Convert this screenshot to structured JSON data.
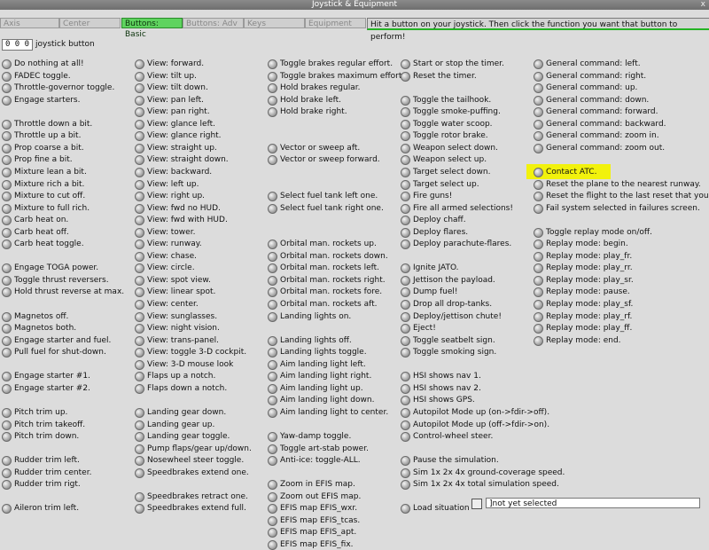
{
  "window": {
    "title": "Joystick & Equipment",
    "close_label": "x"
  },
  "tabs": [
    {
      "label": "Axis"
    },
    {
      "label": "Center"
    },
    {
      "label": "Buttons: Basic"
    },
    {
      "label": "Buttons: Adv"
    },
    {
      "label": "Keys"
    },
    {
      "label": "Equipment"
    }
  ],
  "hint": "Hit a button on your joystick. Then click the function you want that button to perform!",
  "joystick": {
    "value": "0 0 0",
    "label": "joystick button"
  },
  "highlight_color": "#f2f20c",
  "active_tab_color": "#5fd35f",
  "columns": [
    [
      "Do nothing at all!",
      "FADEC toggle.",
      "Throttle-governor toggle.",
      "Engage starters.",
      "",
      "Throttle down a bit.",
      "Throttle up a bit.",
      "Prop coarse a bit.",
      "Prop fine a bit.",
      "Mixture lean a bit.",
      "Mixture rich a bit.",
      "Mixture to cut off.",
      "Mixture to full rich.",
      "Carb heat on.",
      "Carb heat off.",
      "Carb heat toggle.",
      "",
      "Engage TOGA power.",
      "Toggle thrust reversers.",
      "Hold thrust reverse at max.",
      "",
      "Magnetos off.",
      "Magnetos both.",
      "Engage starter and fuel.",
      "Pull fuel for shut-down.",
      "",
      "Engage starter #1.",
      "Engage starter #2.",
      "",
      "Pitch trim up.",
      "Pitch trim takeoff.",
      "Pitch trim down.",
      "",
      "Rudder trim left.",
      "Rudder trim center.",
      "Rudder trim rigt.",
      "",
      "Aileron trim left."
    ],
    [
      "View: forward.",
      "View: tilt up.",
      "View: tilt down.",
      "View: pan left.",
      "View: pan right.",
      "View: glance left.",
      "View: glance right.",
      "View: straight up.",
      "View: straight down.",
      "View: backward.",
      "View: left up.",
      "View: right up.",
      "View: fwd no HUD.",
      "View: fwd with HUD.",
      "View: tower.",
      "View: runway.",
      "View: chase.",
      "View: circle.",
      "View: spot view.",
      "View: linear spot.",
      "View: center.",
      "View: sunglasses.",
      "View: night vision.",
      "View: trans-panel.",
      "View: toggle 3-D cockpit.",
      "View: 3-D mouse look",
      "Flaps up a notch.",
      "Flaps down a notch.",
      "",
      "Landing gear down.",
      "Landing gear up.",
      "Landing gear toggle.",
      "Pump flaps/gear up/down.",
      "Nosewheel steer toggle.",
      "Speedbrakes extend one.",
      "",
      "Speedbrakes retract one.",
      "Speedbrakes extend full."
    ],
    [
      "Toggle brakes regular effort.",
      "Toggle brakes maximum effort.",
      "Hold brakes regular.",
      "Hold brake left.",
      "Hold brake right.",
      "",
      "",
      "Vector or sweep aft.",
      "Vector or sweep forward.",
      "",
      "",
      "Select fuel tank left one.",
      "Select fuel tank right one.",
      "",
      "",
      "Orbital man. rockets up.",
      "Orbital man. rockets down.",
      "Orbital man. rockets left.",
      "Orbital man. rockets right.",
      "Orbital man. rockets fore.",
      "Orbital man. rockets aft.",
      "Landing lights on.",
      "",
      "Landing lights off.",
      "Landing lights toggle.",
      "Aim landing light left.",
      "Aim landing light right.",
      "Aim landing light up.",
      "Aim landing light down.",
      "Aim landing light to center.",
      "",
      "Yaw-damp toggle.",
      "Toggle art-stab power.",
      "Anti-ice: toggle-ALL.",
      "",
      "Zoom in EFIS map.",
      "Zoom out EFIS map.",
      "EFIS map EFIS_wxr.",
      "EFIS map EFIS_tcas.",
      "EFIS map EFIS_apt.",
      "EFIS map EFIS_fix."
    ],
    [
      "Start or stop the timer.",
      "Reset the timer.",
      "",
      "Toggle the tailhook.",
      "Toggle smoke-puffing.",
      "Toggle water scoop.",
      "Toggle rotor brake.",
      "Weapon select down.",
      "Weapon select up.",
      "Target select down.",
      "Target select up.",
      "Fire guns!",
      "Fire all armed selections!",
      "Deploy chaff.",
      "Deploy flares.",
      "Deploy parachute-flares.",
      "",
      "Ignite JATO.",
      "Jettison the payload.",
      "Dump fuel!",
      "Drop all drop-tanks.",
      "Deploy/jettison chute!",
      "Eject!",
      "Toggle seatbelt sign.",
      "Toggle smoking sign.",
      "",
      "HSI shows nav 1.",
      "HSI shows nav 2.",
      "HSI shows GPS.",
      "Autopilot Mode up (on->fdir->off).",
      "Autopilot Mode up (off->fdir->on).",
      "Control-wheel steer.",
      "",
      "Pause the simulation.",
      "Sim 1x 2x 4x ground-coverage speed.",
      "Sim 1x 2x 4x total simulation speed.",
      "",
      "Load situation"
    ],
    [
      "General command: left.",
      "General command: right.",
      "General command: up.",
      "General command: down.",
      "General command: forward.",
      "General command: backward.",
      "General command: zoom in.",
      "General command: zoom out.",
      "",
      "Contact ATC.",
      "Reset the plane to the nearest runway.",
      "Reset the flight to the last reset that you did.",
      "Fail system selected in failures screen.",
      "",
      "Toggle replay mode on/off.",
      "Replay mode: begin.",
      "Replay mode: play_fr.",
      "Replay mode: play_rr.",
      "Replay mode: play_sr.",
      "Replay mode: pause.",
      "Replay mode: play_sf.",
      "Replay mode: play_rf.",
      "Replay mode: play_ff.",
      "Replay mode: end."
    ]
  ],
  "highlighted_item": "Contact ATC.",
  "footer": {
    "field_value": "]not yet selected"
  }
}
